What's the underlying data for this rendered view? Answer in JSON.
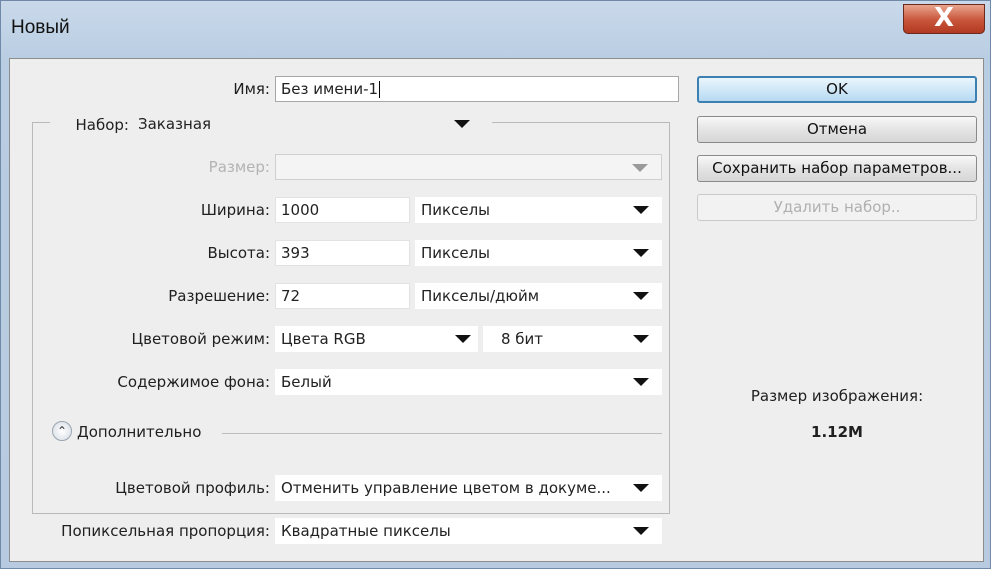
{
  "window": {
    "title": "Новый",
    "close_glyph": "X"
  },
  "form": {
    "name": {
      "label": "Имя:",
      "value": "Без имени-1"
    },
    "preset": {
      "label": "Набор:",
      "value": "Заказная"
    },
    "size": {
      "label": "Размер:",
      "value": ""
    },
    "width": {
      "label": "Ширина:",
      "value": "1000",
      "unit": "Пикселы"
    },
    "height": {
      "label": "Высота:",
      "value": "393",
      "unit": "Пикселы"
    },
    "resolution": {
      "label": "Разрешение:",
      "value": "72",
      "unit": "Пикселы/дюйм"
    },
    "color_mode": {
      "label": "Цветовой режим:",
      "value": "Цвета RGB",
      "depth": "8 бит"
    },
    "background": {
      "label": "Содержимое фона:",
      "value": "Белый"
    },
    "advanced": {
      "label": "Дополнительно",
      "icon": "chevron-up-icon"
    },
    "color_profile": {
      "label": "Цветовой профиль:",
      "value": "Отменить управление цветом в докуме..."
    },
    "pixel_aspect": {
      "label": "Попиксельная пропорция:",
      "value": "Квадратные пикселы"
    }
  },
  "buttons": {
    "ok": "OK",
    "cancel": "Отмена",
    "save_preset": "Сохранить набор параметров...",
    "delete_preset": "Удалить набор.."
  },
  "image_size": {
    "label": "Размер изображения:",
    "value": "1.12M"
  }
}
